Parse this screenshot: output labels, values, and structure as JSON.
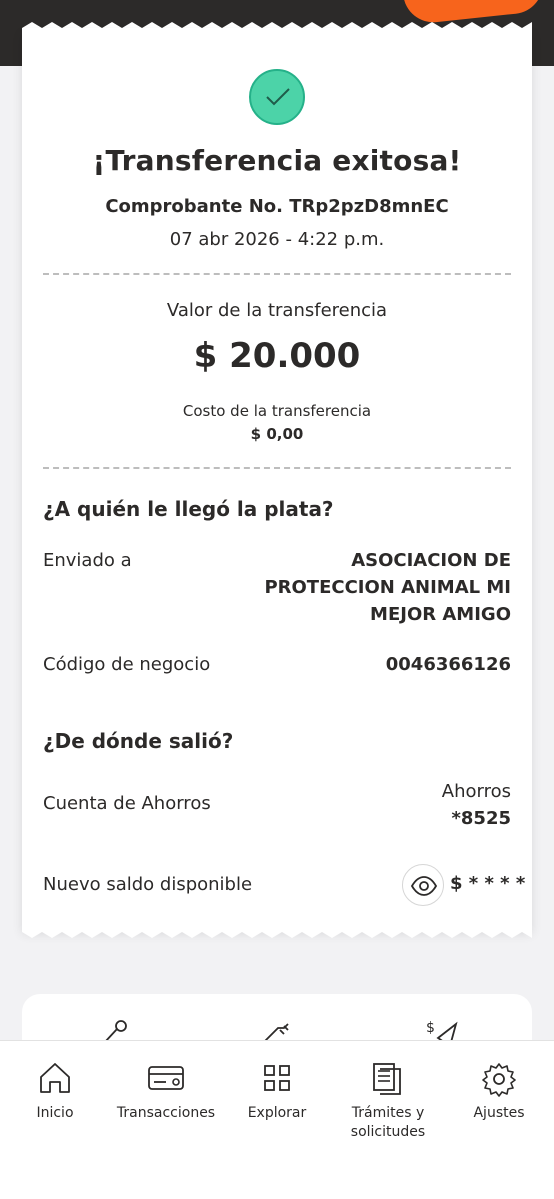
{
  "receipt": {
    "title": "¡Transferencia exitosa!",
    "voucher": "Comprobante No. TRp2pzD8mnEC",
    "datetime": "07 abr 2026 - 4:22 p.m.",
    "amount_label": "Valor de la transferencia",
    "amount": "$ 20.000",
    "cost_label": "Costo de la transferencia",
    "cost_value": "$ 0,00"
  },
  "recipient": {
    "section_title": "¿A quién le llegó la plata?",
    "sent_to_label": "Enviado a",
    "sent_to_lines": [
      "ASOCIACION DE",
      "PROTECCION ANIMAL MI",
      "MEJOR AMIGO"
    ],
    "business_code_label": "Código de negocio",
    "business_code": "0046366126"
  },
  "source": {
    "section_title": "¿De dónde salió?",
    "account_label": "Cuenta de Ahorros",
    "account_type": "Ahorros",
    "account_number": "*8525",
    "balance_label": "Nuevo saldo disponible",
    "balance_masked": "$ * * * *"
  },
  "tabbar": {
    "items": [
      {
        "label": "Inicio",
        "icon": "home-icon"
      },
      {
        "label": "Transacciones",
        "icon": "card-icon"
      },
      {
        "label": "Explorar",
        "icon": "grid-icon"
      },
      {
        "label": "Trámites y solicitudes",
        "icon": "documents-icon"
      },
      {
        "label": "Ajustes",
        "icon": "gear-icon"
      }
    ]
  },
  "colors": {
    "success": "#4cd3a8",
    "dark": "#2c2a29",
    "accent_orange": "#f7641c",
    "accent_blue": "#3fb7e8"
  }
}
